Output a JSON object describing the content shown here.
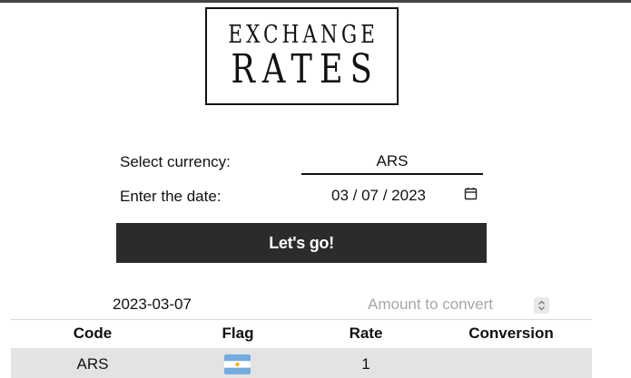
{
  "logo": {
    "line1": "EXCHANGE",
    "line2": "RATES"
  },
  "form": {
    "currency_label": "Select currency:",
    "currency_value": "ARS",
    "date_label": "Enter the date:",
    "date_value": "03 / 07 / 2023",
    "submit_label": "Let's go!"
  },
  "results": {
    "date": "2023-03-07",
    "amount_placeholder": "Amount to convert",
    "columns": [
      "Code",
      "Flag",
      "Rate",
      "Conversion"
    ],
    "rows": [
      {
        "code": "ARS",
        "flag": "argentina-flag",
        "rate": "1",
        "conversion": ""
      }
    ]
  },
  "colors": {
    "button_bg": "#2b2a2c",
    "row_bg": "#e3e3e5",
    "placeholder": "#a6a6ad",
    "flag_blue": "#74acdf"
  }
}
